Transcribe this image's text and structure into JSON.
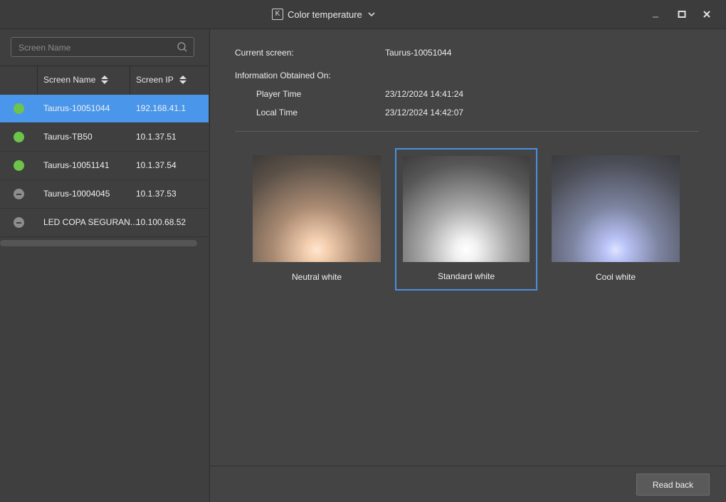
{
  "window": {
    "app_badge": "K",
    "title": "Color temperature",
    "title_dropdown_icon": "chevron-down-icon",
    "minimize_icon": "minimize-icon",
    "maximize_icon": "maximize-icon",
    "close_icon": "close-icon"
  },
  "sidebar": {
    "search": {
      "placeholder": "Screen Name",
      "value": "",
      "icon": "search-icon"
    },
    "columns": [
      {
        "label": "Screen Name",
        "sort_icon": "sort-icon"
      },
      {
        "label": "Screen IP",
        "sort_icon": "sort-icon"
      }
    ],
    "rows": [
      {
        "status": "online",
        "name": "Taurus-10051044",
        "ip": "192.168.41.1",
        "selected": true
      },
      {
        "status": "online",
        "name": "Taurus-TB50",
        "ip": "10.1.37.51",
        "selected": false
      },
      {
        "status": "online",
        "name": "Taurus-10051141",
        "ip": "10.1.37.54",
        "selected": false
      },
      {
        "status": "offline",
        "name": "Taurus-10004045",
        "ip": "10.1.37.53",
        "selected": false
      },
      {
        "status": "offline",
        "name": "LED COPA SEGURAN...",
        "ip": "10.100.68.52",
        "selected": false
      }
    ],
    "status_colors": {
      "online": "#6cc54a",
      "offline": "#8d8d8d",
      "selected_row": "#4a96ea"
    }
  },
  "info": {
    "current_screen_label": "Current screen:",
    "current_screen_value": "Taurus-10051044",
    "obtained_label": "Information Obtained On:",
    "player_time_label": "Player Time",
    "player_time_value": "23/12/2024 14:41:24",
    "local_time_label": "Local Time",
    "local_time_value": "23/12/2024 14:42:07"
  },
  "presets": [
    {
      "label": "Neutral white",
      "glow_color": "#ffe4cc",
      "selected": false
    },
    {
      "label": "Standard white",
      "glow_color": "#ffffff",
      "selected": true
    },
    {
      "label": "Cool white",
      "glow_color": "#c8d2ff",
      "selected": false
    }
  ],
  "footer": {
    "read_back_label": "Read back"
  }
}
